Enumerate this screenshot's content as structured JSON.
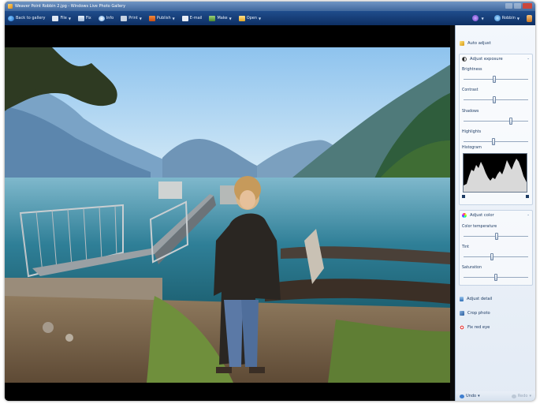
{
  "window": {
    "title": "Weaver Point Robbin 2.jpg - Windows Live Photo Gallery"
  },
  "toolbar": {
    "back": "Back to gallery",
    "file": "File",
    "fix": "Fix",
    "info": "Info",
    "print": "Print",
    "publish": "Publish",
    "email": "E-mail",
    "make": "Make",
    "open": "Open",
    "signin": "Robbin"
  },
  "panel": {
    "auto_adjust": "Auto adjust",
    "exposure": {
      "title": "Adjust exposure",
      "sliders": [
        {
          "label": "Brightness",
          "value": 0.48
        },
        {
          "label": "Contrast",
          "value": 0.47
        },
        {
          "label": "Shadows",
          "value": 0.74
        },
        {
          "label": "Highlights",
          "value": 0.46
        }
      ],
      "histogram_label": "Histogram"
    },
    "color": {
      "title": "Adjust color",
      "sliders": [
        {
          "label": "Color temperature",
          "value": 0.51
        },
        {
          "label": "Tint",
          "value": 0.44
        },
        {
          "label": "Saturation",
          "value": 0.5
        }
      ]
    },
    "adjust_detail": "Adjust detail",
    "crop_photo": "Crop photo",
    "fix_red_eye": "Fix red eye"
  },
  "statusbar": {
    "undo": "Undo",
    "redo": "Redo"
  },
  "colors": {
    "toolbar": "#163f7a",
    "panel": "#eef3f9",
    "accent": "#2f6fb6"
  }
}
